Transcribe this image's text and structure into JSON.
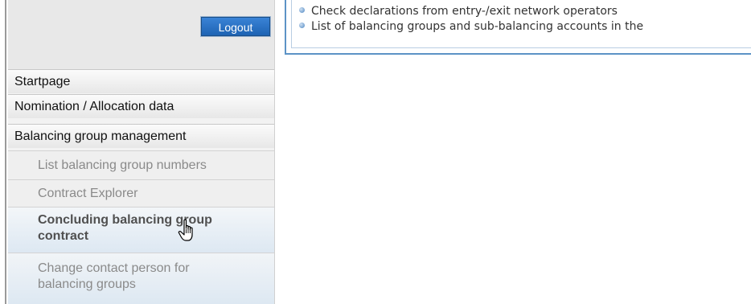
{
  "header": {
    "logout_label": "Logout"
  },
  "info": {
    "bullets": [
      "Check declarations from entry-/exit network operators",
      "List of balancing groups and sub-balancing accounts in the"
    ]
  },
  "sidebar": {
    "menu": [
      {
        "label": "Startpage"
      },
      {
        "label": "Nomination / Allocation data"
      },
      {
        "label": "Balancing group management"
      }
    ],
    "submenu": [
      {
        "label": "List balancing group numbers"
      },
      {
        "label": "Contract Explorer"
      },
      {
        "label": "Concluding balancing group contract",
        "line1": "Concluding balancing group",
        "line2": "contract"
      },
      {
        "label": "Change contact person for balancing groups",
        "line1": "Change contact person for",
        "line2": "balancing groups"
      }
    ]
  },
  "icons": {
    "cursor": "hand-pointer-icon",
    "bullet": "bullet-dot-icon"
  },
  "colors": {
    "accent": "#1d63b3",
    "box_border": "#5c93c6"
  }
}
